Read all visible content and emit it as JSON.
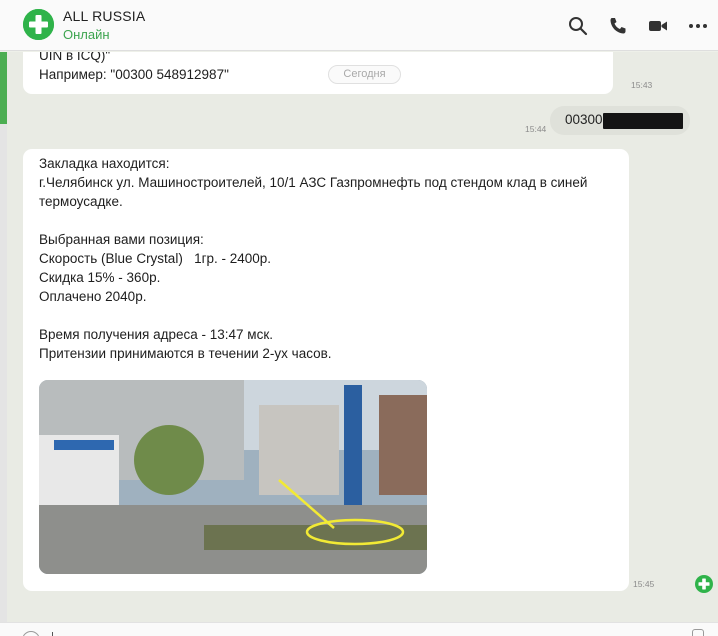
{
  "header": {
    "title": "ALL RUSSIA",
    "status": "Онлайн",
    "icons": [
      "search-icon",
      "phone-icon",
      "video-icon",
      "more-icon"
    ],
    "colors": {
      "accent": "#2fb34a",
      "status": "#3da44f"
    }
  },
  "messages": {
    "first": {
      "lines": [
        "UIN в ICQ)\"",
        "Например: \"00300 548912987\""
      ],
      "time": "15:43"
    },
    "date_chip": "Сегодня",
    "outgoing": {
      "text": "00300",
      "time": "15:44"
    },
    "second": {
      "lines": [
        "Закладка находится:",
        "г.Челябинск ул. Машиностроителей, 10/1 АЗС Газпромнефть под стендом клад в синей",
        "термоусадке.",
        "",
        "Выбранная вами позиция:",
        "Скорость (Blue Crystal)   1гр. - 2400р.",
        "Скидка 15% - 360р.",
        "Оплачено 2040р.",
        "",
        "Время получения адреса - 13:47 мск.",
        "Притензии принимаются в течении 2-ух часов."
      ],
      "time": "15:45"
    }
  }
}
